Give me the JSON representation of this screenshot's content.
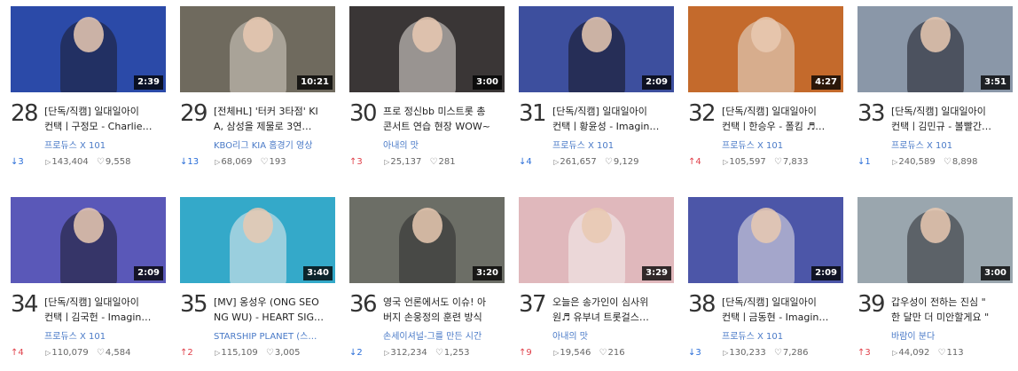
{
  "videos": [
    {
      "rank": "28",
      "duration": "2:39",
      "title1": "[단독/직캠] 일대일아이",
      "title2": "컨택ㅣ구정모 - Charlie…",
      "channel": "프로듀스 X 101",
      "change": "↓3",
      "dir": "down",
      "plays": "143,404",
      "likes": "9,558",
      "bg": "#2b4aa8",
      "fig": "#1b1b2a"
    },
    {
      "rank": "29",
      "duration": "10:21",
      "title1": "[전체HL] '터커 3타점' KI",
      "title2": "A, 삼성을 제물로 3연…",
      "channel": "KBO리그 KIA 홈경기 영상",
      "change": "↓13",
      "dir": "down",
      "plays": "68,069",
      "likes": "193",
      "bg": "#6f6a5e",
      "fig": "#d9d2c8"
    },
    {
      "rank": "30",
      "duration": "3:00",
      "title1": "프로 정신bb 미스트롯 총",
      "title2": "콘서트 연습 현장 WOW~",
      "channel": "아내의 맛",
      "change": "↑3",
      "dir": "up",
      "plays": "25,137",
      "likes": "281",
      "bg": "#3a3636",
      "fig": "#e8e2dc"
    },
    {
      "rank": "31",
      "duration": "2:09",
      "title1": "[단독/직캠] 일대일아이",
      "title2": "컨택ㅣ황윤성 - Imagin…",
      "channel": "프로듀스 X 101",
      "change": "↓4",
      "dir": "down",
      "plays": "261,657",
      "likes": "9,129",
      "bg": "#3d4f9e",
      "fig": "#14141e"
    },
    {
      "rank": "32",
      "duration": "4:27",
      "title1": "[단독/직캠] 일대일아이",
      "title2": "컨택ㅣ한승우 - 폴킴 ♬…",
      "channel": "프로듀스 X 101",
      "change": "↑4",
      "dir": "up",
      "plays": "105,597",
      "likes": "7,833",
      "bg": "#c46a2c",
      "fig": "#e8e4df"
    },
    {
      "rank": "33",
      "duration": "3:51",
      "title1": "[단독/직캠] 일대일아이",
      "title2": "컨택ㅣ김민규 - 볼빨간…",
      "channel": "프로듀스 X 101",
      "change": "↓1",
      "dir": "down",
      "plays": "240,589",
      "likes": "8,898",
      "bg": "#8a97a8",
      "fig": "#1a1a22"
    },
    {
      "rank": "34",
      "duration": "2:09",
      "title1": "[단독/직캠] 일대일아이",
      "title2": "컨택ㅣ김국헌 - Imagin…",
      "channel": "프로듀스 X 101",
      "change": "↑4",
      "dir": "up",
      "plays": "110,079",
      "likes": "4,584",
      "bg": "#5a58b8",
      "fig": "#1a1a26"
    },
    {
      "rank": "35",
      "duration": "3:40",
      "title1": "[MV] 옹성우 (ONG SEO",
      "title2": "NG WU) - HEART SIG…",
      "channel": "STARSHIP PLANET (스…",
      "change": "↑2",
      "dir": "up",
      "plays": "115,109",
      "likes": "3,005",
      "bg": "#34a9c9",
      "fig": "#eeeeee"
    },
    {
      "rank": "36",
      "duration": "3:20",
      "title1": "영국 언론에서도 이슈! 아",
      "title2": "버지 손웅정의 훈련 방식",
      "channel": "손세이셔널-그를 만든 시간",
      "change": "↓2",
      "dir": "down",
      "plays": "312,234",
      "likes": "1,253",
      "bg": "#6c6e66",
      "fig": "#2b2b2b"
    },
    {
      "rank": "37",
      "duration": "3:29",
      "title1": "오늘은 송가인이 심사위",
      "title2": "원♬ 유부녀 트롯걸스…",
      "channel": "아내의 맛",
      "change": "↑9",
      "dir": "up",
      "plays": "19,546",
      "likes": "216",
      "bg": "#e0b8bc",
      "fig": "#f4f0ee"
    },
    {
      "rank": "38",
      "duration": "2:09",
      "title1": "[단독/직캠] 일대일아이",
      "title2": "컨택ㅣ금동현 - Imagin…",
      "channel": "프로듀스 X 101",
      "change": "↓3",
      "dir": "down",
      "plays": "130,233",
      "likes": "7,286",
      "bg": "#4c56a8",
      "fig": "#eceae8"
    },
    {
      "rank": "39",
      "duration": "3:00",
      "title1": "갑우성이 전하는 진심 \"",
      "title2": "한 달만 더 미안할게요 \"",
      "channel": "바람이 분다",
      "change": "↑3",
      "dir": "up",
      "plays": "44,092",
      "likes": "113",
      "bg": "#9aa6ae",
      "fig": "#2a2a30"
    }
  ]
}
